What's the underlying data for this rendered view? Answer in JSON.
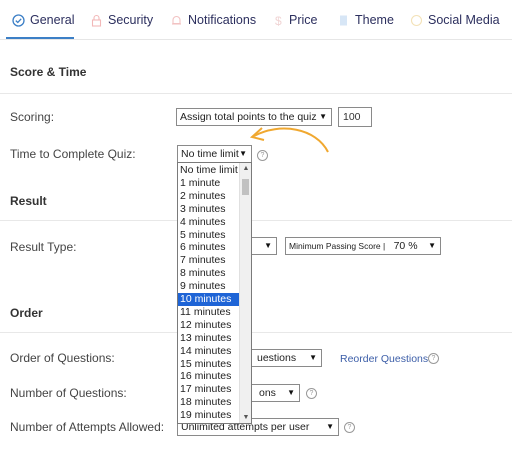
{
  "tabs": [
    {
      "label": "General",
      "icon": "check-circle-icon",
      "active": true
    },
    {
      "label": "Security",
      "icon": "lock-icon"
    },
    {
      "label": "Notifications",
      "icon": "bell-icon"
    },
    {
      "label": "Price",
      "icon": "dollar-icon"
    },
    {
      "label": "Theme",
      "icon": "palette-icon"
    },
    {
      "label": "Social Media",
      "icon": "share-icon"
    }
  ],
  "score_time": {
    "title": "Score & Time",
    "scoring_label": "Scoring:",
    "scoring_value": "Assign total points to the quiz",
    "points_value": "100",
    "time_label": "Time to Complete Quiz:",
    "time_value": "No time limit"
  },
  "result": {
    "title": "Result",
    "type_label": "Result Type:",
    "passing_label": "Minimum Passing Score |",
    "passing_value": "70 %"
  },
  "order": {
    "title": "Order",
    "order_label": "Order of Questions:",
    "order_value_partial": "uestions",
    "reorder_link": "Reorder Questions",
    "number_label": "Number of Questions:",
    "number_value_partial": "ons",
    "attempts_label": "Number of Attempts Allowed:",
    "attempts_value": "Unlimited attempts per user"
  },
  "time_options": [
    "No time limit",
    "1 minute",
    "2 minutes",
    "3 minutes",
    "4 minutes",
    "5 minutes",
    "6 minutes",
    "7 minutes",
    "8 minutes",
    "9 minutes",
    "10 minutes",
    "11 minutes",
    "12 minutes",
    "13 minutes",
    "14 minutes",
    "15 minutes",
    "16 minutes",
    "17 minutes",
    "18 minutes",
    "19 minutes"
  ],
  "selected_option": "10 minutes",
  "colors": {
    "accent": "#3c7fc6",
    "selection": "#1e64d6",
    "annotation_arrow": "#f0a830",
    "tab_text": "#2c2f5e"
  }
}
